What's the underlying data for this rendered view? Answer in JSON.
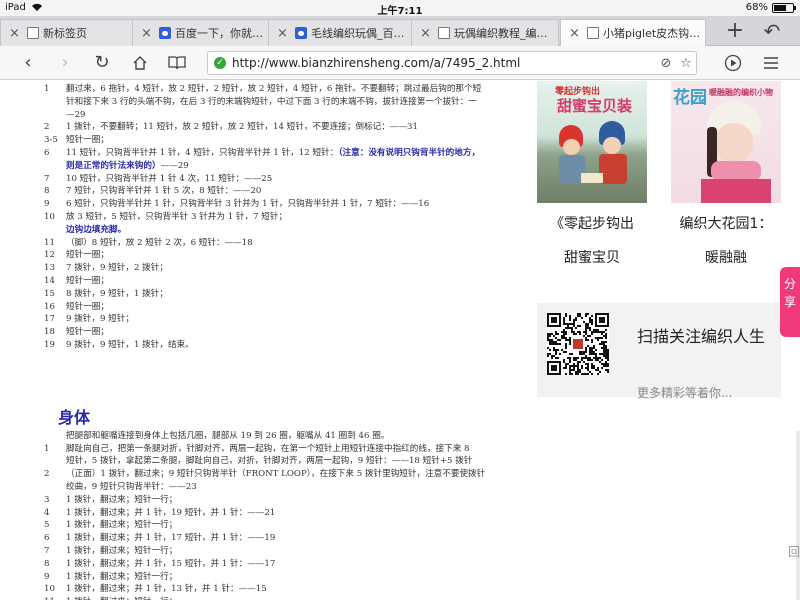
{
  "status": {
    "device": "iPad",
    "time": "上午7:11",
    "battery": "68%",
    "battery_level": 0.68
  },
  "tabs": [
    {
      "label": "新标签页",
      "icon": "document-icon",
      "active": false
    },
    {
      "label": "百度一下，你就…",
      "icon": "baidu-paw-icon",
      "active": false
    },
    {
      "label": "毛线编织玩偶_百…",
      "icon": "baidu-paw-icon",
      "active": false
    },
    {
      "label": "玩偶编织教程_编…",
      "icon": "document-icon",
      "active": false
    },
    {
      "label": "小猪piglet皮杰钩…",
      "icon": "document-icon",
      "active": true
    }
  ],
  "toolbar": {
    "url": "http://www.bianzhirensheng.com/a/7495_2.html"
  },
  "scan": {
    "lines": [
      {
        "n": "1",
        "t": "翻过来，6 拖针，4 短针，放 2 短针，2 短针，放 2 短针，4 短针，6 拖针。不要翻转；跳过最后钩的那个短"
      },
      {
        "n": "",
        "t": "针和接下来 3 行的头端不钩，在后 3 行的末端钩短针，中过下面 3 行的末端不钩，拔针连接第一个拔针：一"
      },
      {
        "n": "",
        "t": "—29"
      },
      {
        "n": "2",
        "t": "1 拨针，不要翻转；11 短针，放 2 短针，放 2 短针，14 短针，不要连接；倒标记：——31"
      },
      {
        "n": "3-5",
        "t": "短针一圈；"
      },
      {
        "n": "6",
        "t": "11 短针，只钩背半针并 1 针，4 短针，只钩背半针并 1 针，12 短针：",
        "b": "（注意：没有说明只钩背半针的地方，"
      },
      {
        "n": "",
        "t": "",
        "b": "则是正常的针法来钩的）",
        "t2": "——29"
      },
      {
        "n": "7",
        "t": "10 短针，只钩背半针并 1 针 4 次，11 短针：——25"
      },
      {
        "n": "8",
        "t": "7 短针，只钩背半针并 1 针 5 次，8 短针：——20"
      },
      {
        "n": "9",
        "t": "6 短针，只钩背半针并 1 针，只钩背半针 3 针并为 1 针，只钩背半针并 1 针，7 短针：——16"
      },
      {
        "n": "10",
        "t": "放 3 短针，5 短针，只钩背半针 3 针并为 1 针，7 短针；"
      },
      {
        "n": "",
        "t": "",
        "b": "边钩边填充脚。"
      },
      {
        "n": "11",
        "t": "（脚）8 短针，放 2 短针 2 次，6 短针：——18"
      },
      {
        "n": "12",
        "t": "短针一圈；"
      },
      {
        "n": "13",
        "t": "7 拨针，9 短针，2 拨针；"
      },
      {
        "n": "14",
        "t": "短针一圈；"
      },
      {
        "n": "15",
        "t": "8 拨针，9 短针，1 拨针；"
      },
      {
        "n": "16",
        "t": "短针一圈；"
      },
      {
        "n": "17",
        "t": "9 拨针，9 短针；"
      },
      {
        "n": "18",
        "t": "短针一圈；"
      },
      {
        "n": "19",
        "t": "9 拨针，9 短针，1 拨针，结束。"
      }
    ],
    "section_title": "身体",
    "lines2": [
      {
        "n": "",
        "t": "把腿部和躯嘴连接到身体上包括几圈，腿部从 19 到 26 圈，躯嘴从 41 圈到 46 圈。"
      },
      {
        "n": "1",
        "t": "脚趾向自己，把第一条腿对折，针脚对齐，两层一起钩，在第一个短针上用短针连接中指红的线，接下来 8"
      },
      {
        "n": "",
        "t": "短针，5 拨针，拿起第二条腿，脚趾向自己，对折，针脚对齐，两层一起钩，9 短针：——18 短针+5 拨针"
      },
      {
        "n": "2",
        "t": "（正面）1 拨针，翻过来；9 短针只钩背半针（FRONT LOOP），在接下来 5 拨针里钩短针，注意不要使拨针"
      },
      {
        "n": "",
        "t": "绞曲，9 短针只钩背半针：——23"
      },
      {
        "n": "3",
        "t": "1 拨针，翻过来；短针一行；"
      },
      {
        "n": "4",
        "t": "1 拨针，翻过来；并 1 针，19 短针，并 1 针：——21"
      },
      {
        "n": "5",
        "t": "1 拨针，翻过来；短针一行；"
      },
      {
        "n": "6",
        "t": "1 拨针，翻过来；并 1 针，17 短针，并 1 针：——19"
      },
      {
        "n": "7",
        "t": "1 拨针，翻过来；短针一行；"
      },
      {
        "n": "8",
        "t": "1 拨针，翻过来；并 1 针，15 短针，并 1 针：——17"
      },
      {
        "n": "9",
        "t": "1 拨针，翻过来；短针一行；"
      },
      {
        "n": "10",
        "t": "1 拨针，翻过来；并 1 针，13 针，并 1 针：——15"
      },
      {
        "n": "11",
        "t": "1 拨针，翻过来；短针一行；"
      }
    ]
  },
  "books": [
    {
      "title": "《零起步钩出",
      "subtitle": "甜蜜宝贝",
      "cover_text": "甜蜜宝贝装",
      "cover_top": "零起步钩出"
    },
    {
      "title": "编织大花园1：",
      "subtitle": "暖融融",
      "cover_text": "花园",
      "cover_top": "暖融融的编织小物"
    }
  ],
  "follow": {
    "title": "扫描关注编织人生",
    "subtitle": "更多精彩等着你..."
  },
  "share_label": "分享",
  "scroll_hint": "回"
}
